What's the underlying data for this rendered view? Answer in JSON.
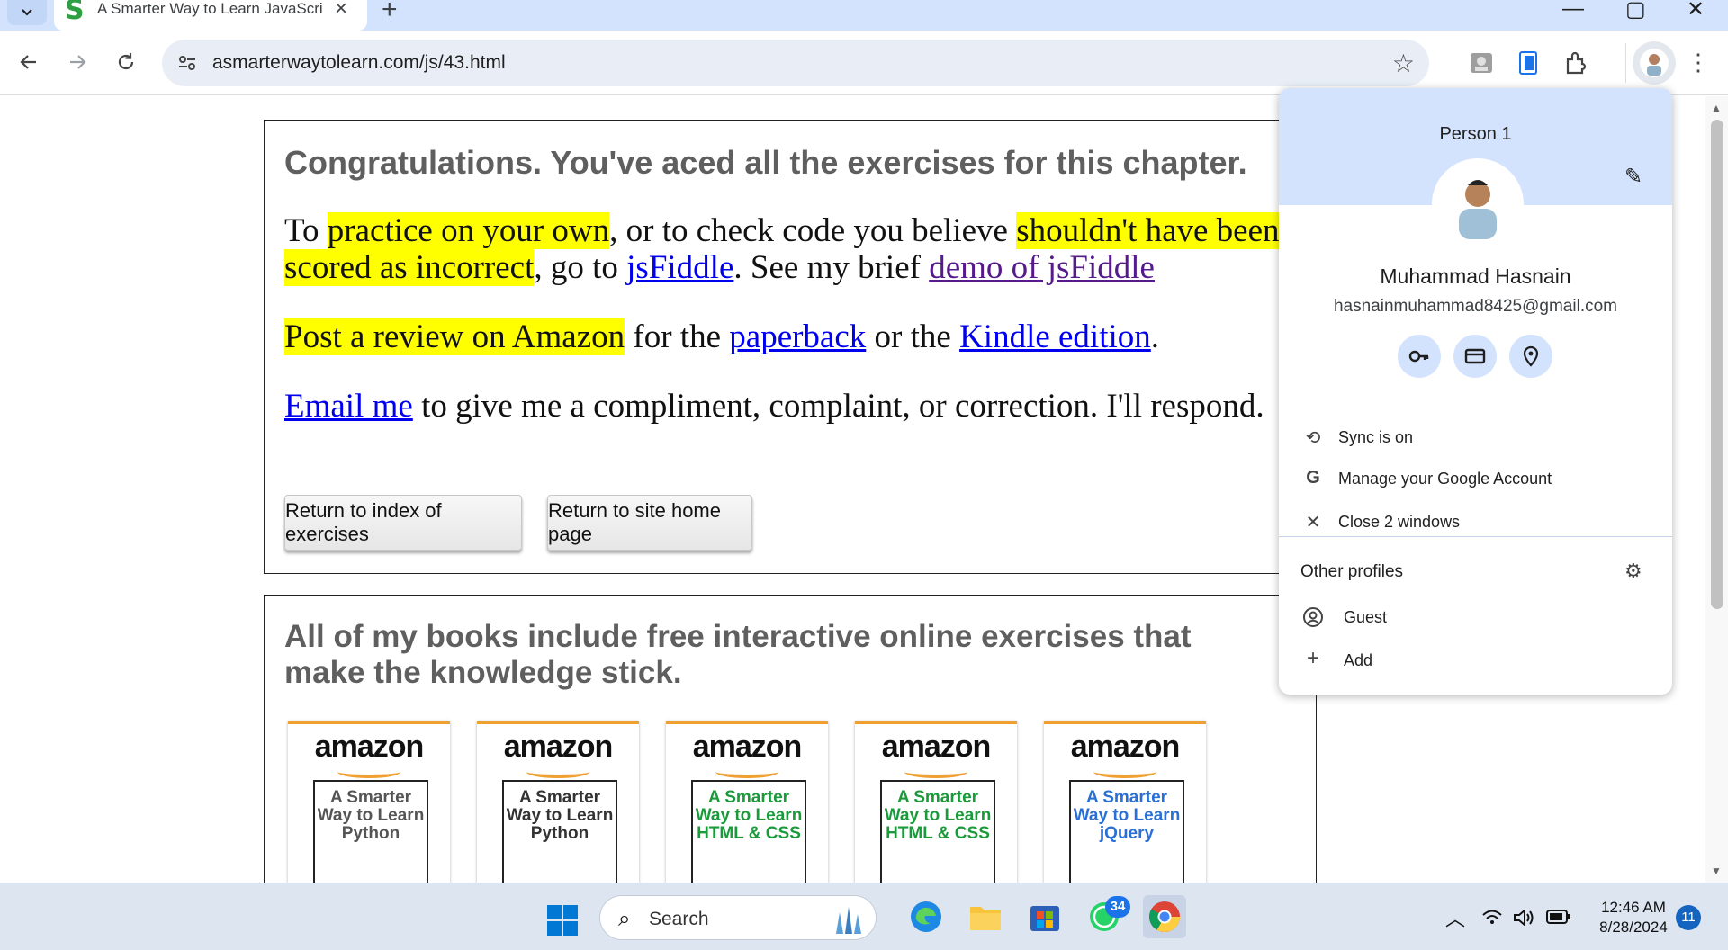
{
  "browser": {
    "tab_title": "A Smarter Way to Learn JavaScript",
    "tab_favicon": "S",
    "new_tab": "+",
    "url": "asmarterwaytolearn.com/js/43.html",
    "window_controls": [
      "—",
      "▢",
      "✕"
    ]
  },
  "page": {
    "congrats": "Congratulations. You've aced all the exercises for this chapter.",
    "p1": {
      "t1": "To ",
      "h1": "practice on your own",
      "t2": ", or to check code you believe ",
      "h2": "shouldn't have been scored as incorrect",
      "t3": ", go to ",
      "link1": "jsFiddle",
      "t4": ". See my brief ",
      "link2": "demo of jsFiddle"
    },
    "p2": {
      "h1": "Post a review on Amazon",
      "t1": " for the ",
      "link1": "paperback",
      "t2": " or the ",
      "link2": "Kindle edition",
      "t3": "."
    },
    "p3": {
      "link1": "Email me",
      "t1": " to give me a compliment, complaint, or correction. I'll respond."
    },
    "buttons": {
      "index": "Return to index of exercises",
      "home": "Return to site home page"
    },
    "books_heading": "All of my books include free interactive online exercises that make the knowledge stick.",
    "books": [
      {
        "brand": "amazon",
        "title": "A Smarter Way to Learn Python",
        "color": "#555555"
      },
      {
        "brand": "amazon",
        "title": "A Smarter Way to Learn Python",
        "color": "#333333"
      },
      {
        "brand": "amazon",
        "title": "A Smarter Way to Learn HTML & CSS",
        "color": "#1a9a3a"
      },
      {
        "brand": "amazon",
        "title": "A Smarter Way to Learn HTML & CSS",
        "color": "#1a9a3a"
      },
      {
        "brand": "amazon",
        "title": "A Smarter Way to Learn jQuery",
        "color": "#2a6fd6"
      }
    ]
  },
  "profile_menu": {
    "person_label": "Person 1",
    "name": "Muhammad Hasnain",
    "email": "hasnainmuhammad8425@gmail.com",
    "quick_actions": [
      "password-key-icon",
      "payment-card-icon",
      "location-pin-icon"
    ],
    "rows": [
      {
        "icon": "sync-icon",
        "label": "Sync is on"
      },
      {
        "icon": "google-g-icon",
        "label": "Manage your Google Account"
      },
      {
        "icon": "close-icon",
        "label": "Close 2 windows"
      }
    ],
    "other_profiles_title": "Other profiles",
    "other_rows": [
      {
        "icon": "guest-icon",
        "label": "Guest"
      },
      {
        "icon": "add-icon",
        "label": "Add"
      }
    ]
  },
  "taskbar": {
    "search_placeholder": "Search",
    "whatsapp_badge": "34",
    "time": "12:46 AM",
    "date": "8/28/2024",
    "notifications": "11"
  }
}
